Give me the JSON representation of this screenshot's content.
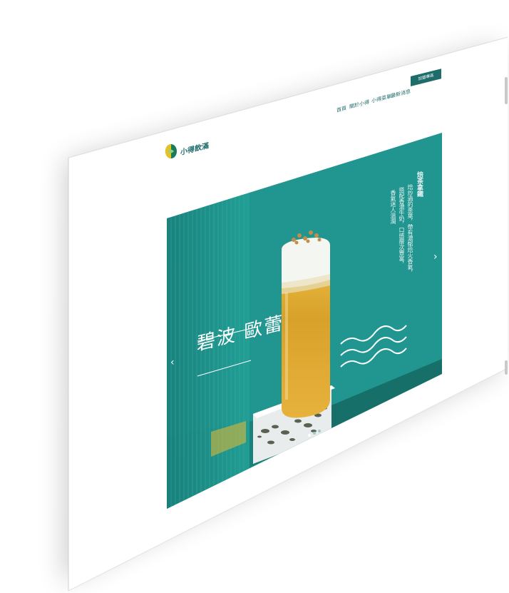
{
  "brand": {
    "name": "小得飲滿",
    "colors": {
      "primary": "#1e6d6b",
      "teal": "#21958f",
      "logo_green": "#1a7a5c",
      "logo_yellow": "#e8c21c"
    }
  },
  "nav": {
    "items": [
      {
        "label": "首頁"
      },
      {
        "label": "關於小得"
      },
      {
        "label": "小得菜單"
      },
      {
        "label": "最新消息"
      }
    ],
    "cta_label": "加盟專區"
  },
  "banner": {
    "title": "碧波 歐蕾",
    "copy_heading": "焙茶拿鐵",
    "copy_lines": [
      "焙炒過的茶葉，帶有濃郁焙火香氣，",
      "搭配香濃牛奶，口感層次豐富，",
      "香氣迷人溫潤"
    ],
    "prev_icon": "chevron-left-icon",
    "next_icon": "chevron-right-icon",
    "slide_count": 3,
    "active_slide": 1
  }
}
